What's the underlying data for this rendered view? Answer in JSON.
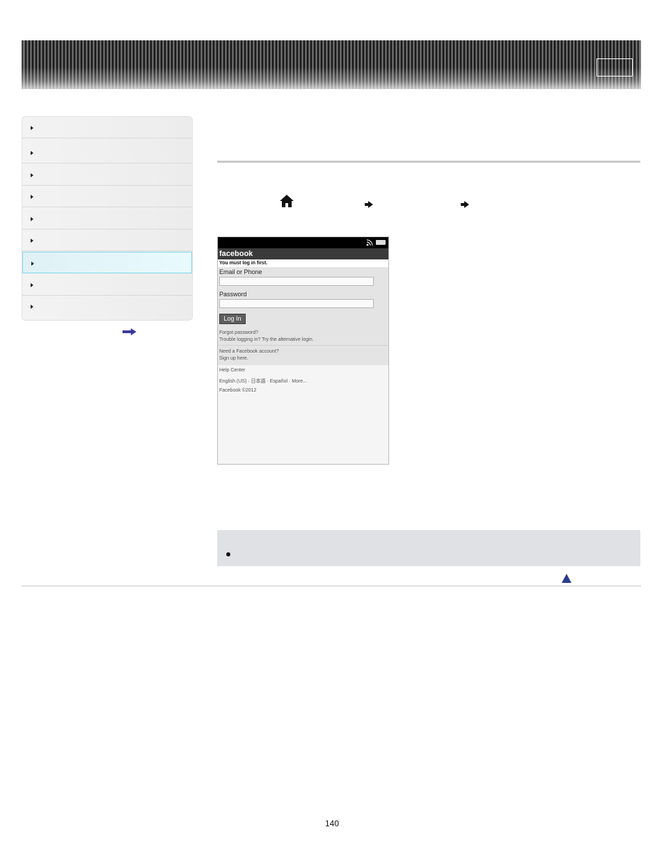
{
  "header": {
    "box_label": ""
  },
  "sidebar": {
    "items": [
      {
        "label": ""
      },
      {
        "label": ""
      },
      {
        "label": ""
      },
      {
        "label": ""
      },
      {
        "label": ""
      },
      {
        "label": ""
      },
      {
        "label": "",
        "active": true
      },
      {
        "label": ""
      },
      {
        "label": ""
      }
    ]
  },
  "steps": {
    "home_icon": "home-icon",
    "arrow_icon": "arrow-right-icon"
  },
  "phone": {
    "fb_logo": "facebook",
    "notice": "You must log in first.",
    "email_label": "Email or Phone",
    "password_label": "Password",
    "login_button": "Log In",
    "forgot_password": "Forgot password?",
    "trouble_login": "Trouble logging in? Try the alternative login.",
    "need_account": "Need a Facebook account?",
    "sign_up": "Sign up here.",
    "help_center": "Help Center",
    "languages": "English (US) · 日本語 · Español · More...",
    "copyright": "Facebook ©2012"
  },
  "note": {
    "bullet_text": ""
  },
  "page_number": "140",
  "colors": {
    "accent": "#3a3a9a",
    "active_nav": "#e8fafd",
    "note_bg": "#dfe1e5"
  }
}
